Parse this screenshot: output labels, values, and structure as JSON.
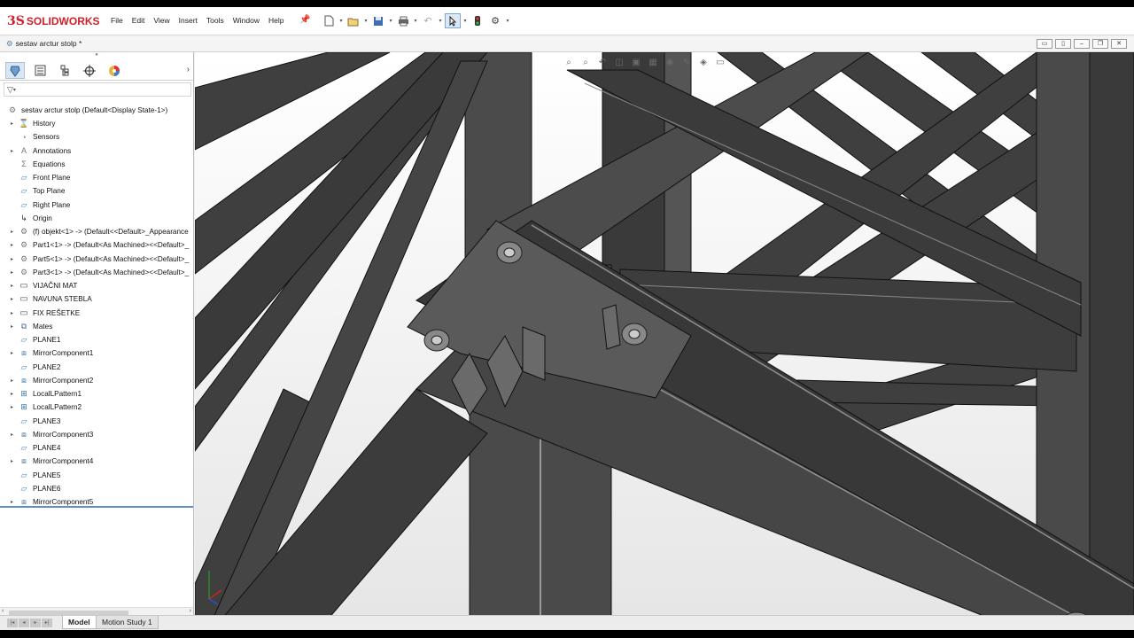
{
  "app": {
    "brand_mark": "3S",
    "brand_name": "SOLIDWORKS",
    "menus": [
      "File",
      "Edit",
      "View",
      "Insert",
      "Tools",
      "Window",
      "Help"
    ]
  },
  "document": {
    "title": "sestav arctur stolp *"
  },
  "feature_tree": {
    "root": "sestav arctur stolp  (Default<Display State-1>)",
    "items": [
      {
        "label": "History",
        "icon": "history-icon",
        "expandable": true
      },
      {
        "label": "Sensors",
        "icon": "sensors-icon",
        "expandable": false
      },
      {
        "label": "Annotations",
        "icon": "annotations-icon",
        "expandable": true
      },
      {
        "label": "Equations",
        "icon": "equations-icon",
        "expandable": false
      },
      {
        "label": "Front Plane",
        "icon": "plane-icon",
        "expandable": false
      },
      {
        "label": "Top Plane",
        "icon": "plane-icon",
        "expandable": false
      },
      {
        "label": "Right Plane",
        "icon": "plane-icon",
        "expandable": false
      },
      {
        "label": "Origin",
        "icon": "origin-icon",
        "expandable": false
      },
      {
        "label": "(f) objekt<1> -> (Default<<Default>_Appearance",
        "icon": "part-icon",
        "expandable": true
      },
      {
        "label": "Part1<1> -> (Default<As Machined><<Default>_",
        "icon": "part-icon",
        "expandable": true
      },
      {
        "label": "Part5<1> -> (Default<As Machined><<Default>_",
        "icon": "part-icon",
        "expandable": true
      },
      {
        "label": "Part3<1> -> (Default<As Machined><<Default>_",
        "icon": "part-icon",
        "expandable": true
      },
      {
        "label": "VIJAČNI MAT",
        "icon": "folder-icon",
        "expandable": true
      },
      {
        "label": "NAVUNA STEBLA",
        "icon": "folder-icon",
        "expandable": true
      },
      {
        "label": "FIX REŠETKE",
        "icon": "folder-icon",
        "expandable": true
      },
      {
        "label": "Mates",
        "icon": "mates-icon",
        "expandable": true
      },
      {
        "label": "PLANE1",
        "icon": "plane-icon",
        "expandable": false
      },
      {
        "label": "MirrorComponent1",
        "icon": "mirror-icon",
        "expandable": true
      },
      {
        "label": "PLANE2",
        "icon": "plane-icon",
        "expandable": false
      },
      {
        "label": "MirrorComponent2",
        "icon": "mirror-icon",
        "expandable": true
      },
      {
        "label": "LocalLPattern1",
        "icon": "pattern-icon",
        "expandable": true
      },
      {
        "label": "LocalLPattern2",
        "icon": "pattern-icon",
        "expandable": true
      },
      {
        "label": "PLANE3",
        "icon": "plane-icon",
        "expandable": false
      },
      {
        "label": "MirrorComponent3",
        "icon": "mirror-icon",
        "expandable": true
      },
      {
        "label": "PLANE4",
        "icon": "plane-icon",
        "expandable": false
      },
      {
        "label": "MirrorComponent4",
        "icon": "mirror-icon",
        "expandable": true
      },
      {
        "label": "PLANE5",
        "icon": "plane-icon",
        "expandable": false
      },
      {
        "label": "PLANE6",
        "icon": "plane-icon",
        "expandable": false
      },
      {
        "label": "MirrorComponent5",
        "icon": "mirror-icon",
        "expandable": true
      }
    ]
  },
  "bottom_tabs": [
    "Model",
    "Motion Study 1"
  ],
  "active_bottom_tab": "Model",
  "colors": {
    "brand_red": "#d1202a",
    "steel_dark": "#3a3a3a",
    "selection_blue": "#5b8fc7"
  }
}
